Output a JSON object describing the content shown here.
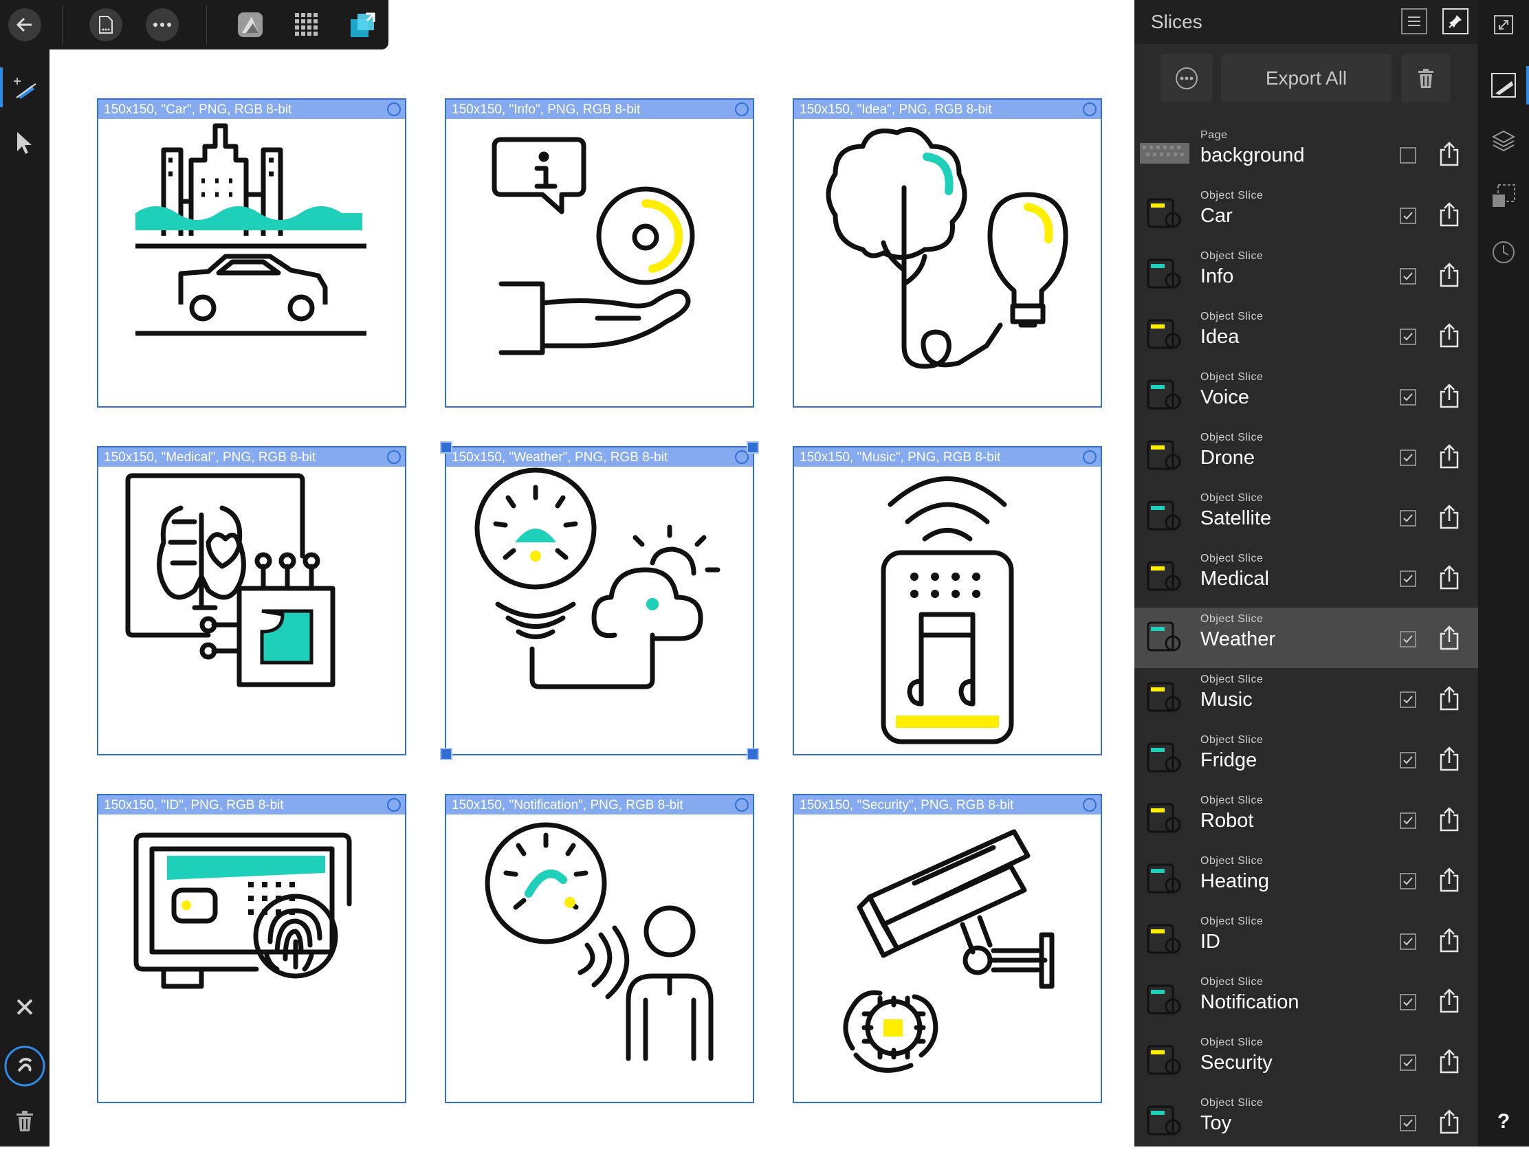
{
  "slices_canvas": [
    {
      "label": "150x150, \"Car\", PNG, RGB 8-bit",
      "icon": "car-city-icon"
    },
    {
      "label": "150x150, \"Info\", PNG, RGB 8-bit",
      "icon": "info-hand-icon"
    },
    {
      "label": "150x150, \"Idea\", PNG, RGB 8-bit",
      "icon": "tree-bulb-icon"
    },
    {
      "label": "150x150, \"Medical\", PNG, RGB 8-bit",
      "icon": "medical-chip-icon"
    },
    {
      "label": "150x150, \"Weather\", PNG, RGB 8-bit",
      "icon": "weather-cloud-icon"
    },
    {
      "label": "150x150, \"Music\", PNG, RGB 8-bit",
      "icon": "music-speaker-icon"
    },
    {
      "label": "150x150, \"ID\", PNG, RGB 8-bit",
      "icon": "id-fingerprint-icon"
    },
    {
      "label": "150x150, \"Notification\", PNG, RGB 8-bit",
      "icon": "notification-person-icon"
    },
    {
      "label": "150x150, \"Security\", PNG, RGB 8-bit",
      "icon": "security-camera-icon"
    }
  ],
  "selected_slice": "Weather",
  "panel": {
    "title": "Slices",
    "export_all_label": "Export All",
    "rows": [
      {
        "type": "Page",
        "name": "background",
        "checked": false
      },
      {
        "type": "Object Slice",
        "name": "Car",
        "checked": true
      },
      {
        "type": "Object Slice",
        "name": "Info",
        "checked": true
      },
      {
        "type": "Object Slice",
        "name": "Idea",
        "checked": true
      },
      {
        "type": "Object Slice",
        "name": "Voice",
        "checked": true
      },
      {
        "type": "Object Slice",
        "name": "Drone",
        "checked": true
      },
      {
        "type": "Object Slice",
        "name": "Satellite",
        "checked": true
      },
      {
        "type": "Object Slice",
        "name": "Medical",
        "checked": true
      },
      {
        "type": "Object Slice",
        "name": "Weather",
        "checked": true
      },
      {
        "type": "Object Slice",
        "name": "Music",
        "checked": true
      },
      {
        "type": "Object Slice",
        "name": "Fridge",
        "checked": true
      },
      {
        "type": "Object Slice",
        "name": "Robot",
        "checked": true
      },
      {
        "type": "Object Slice",
        "name": "Heating",
        "checked": true
      },
      {
        "type": "Object Slice",
        "name": "ID",
        "checked": true
      },
      {
        "type": "Object Slice",
        "name": "Notification",
        "checked": true
      },
      {
        "type": "Object Slice",
        "name": "Security",
        "checked": true
      },
      {
        "type": "Object Slice",
        "name": "Toy",
        "checked": true
      }
    ]
  },
  "help_label": "?",
  "colors": {
    "accent": "#2f6fd6",
    "teal": "#1ecfb9",
    "yellow": "#ffee00",
    "panel": "#2a2a2a",
    "toolbar": "#1b1b1b"
  }
}
